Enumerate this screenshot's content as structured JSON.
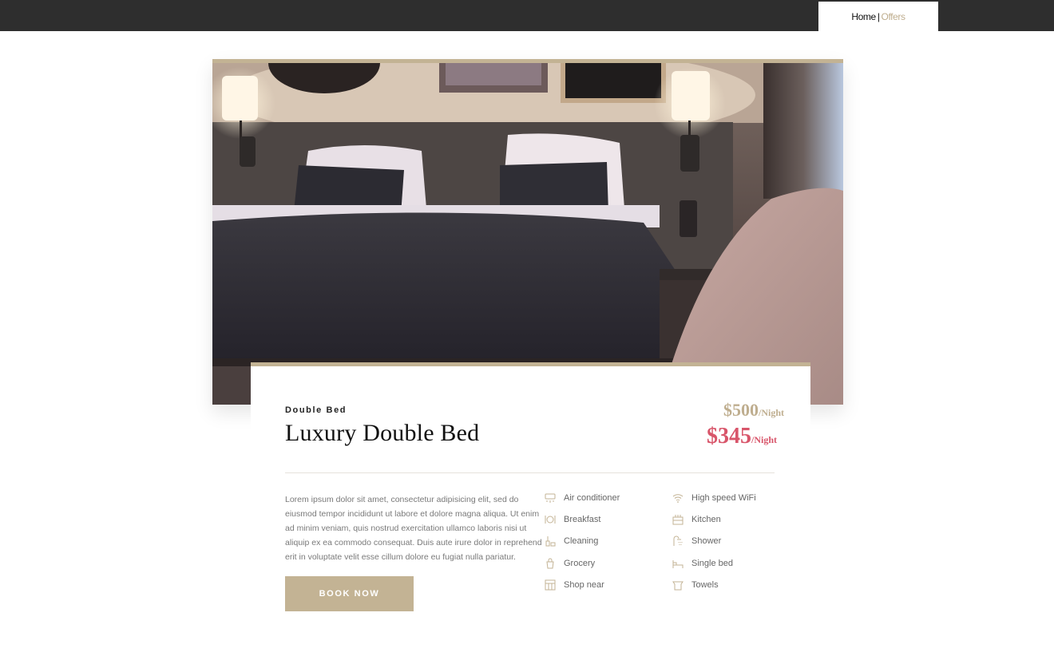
{
  "nav": {
    "home_label": "Home",
    "separator": "|",
    "offers_label": "Offers"
  },
  "room": {
    "type": "Double Bed",
    "title": "Luxury Double Bed",
    "price_old": "$500",
    "price_old_unit": "/Night",
    "price_new": "$345",
    "price_new_unit": "/Night",
    "description": "Lorem ipsum dolor sit amet, consectetur adipisicing elit, sed do eiusmod tempor incididunt ut labore et dolore magna aliqua. Ut enim ad minim veniam, quis nostrud exercitation ullamco laboris nisi ut aliquip ex ea commodo consequat. Duis aute irure dolor in reprehend erit in voluptate velit esse cillum dolore eu fugiat nulla pariatur.",
    "book_label": "BOOK NOW"
  },
  "amenities": [
    {
      "label": "Air conditioner",
      "icon": "air-conditioner-icon"
    },
    {
      "label": "Breakfast",
      "icon": "breakfast-icon"
    },
    {
      "label": "Cleaning",
      "icon": "cleaning-icon"
    },
    {
      "label": "Grocery",
      "icon": "grocery-icon"
    },
    {
      "label": "Shop near",
      "icon": "shop-icon"
    },
    {
      "label": "High speed WiFi",
      "icon": "wifi-icon"
    },
    {
      "label": "Kitchen",
      "icon": "kitchen-icon"
    },
    {
      "label": "Shower",
      "icon": "shower-icon"
    },
    {
      "label": "Single bed",
      "icon": "bed-icon"
    },
    {
      "label": "Towels",
      "icon": "towel-icon"
    }
  ],
  "colors": {
    "accent": "#c3b394",
    "price_new": "#d8556a",
    "topbar": "#2e2e2e"
  }
}
